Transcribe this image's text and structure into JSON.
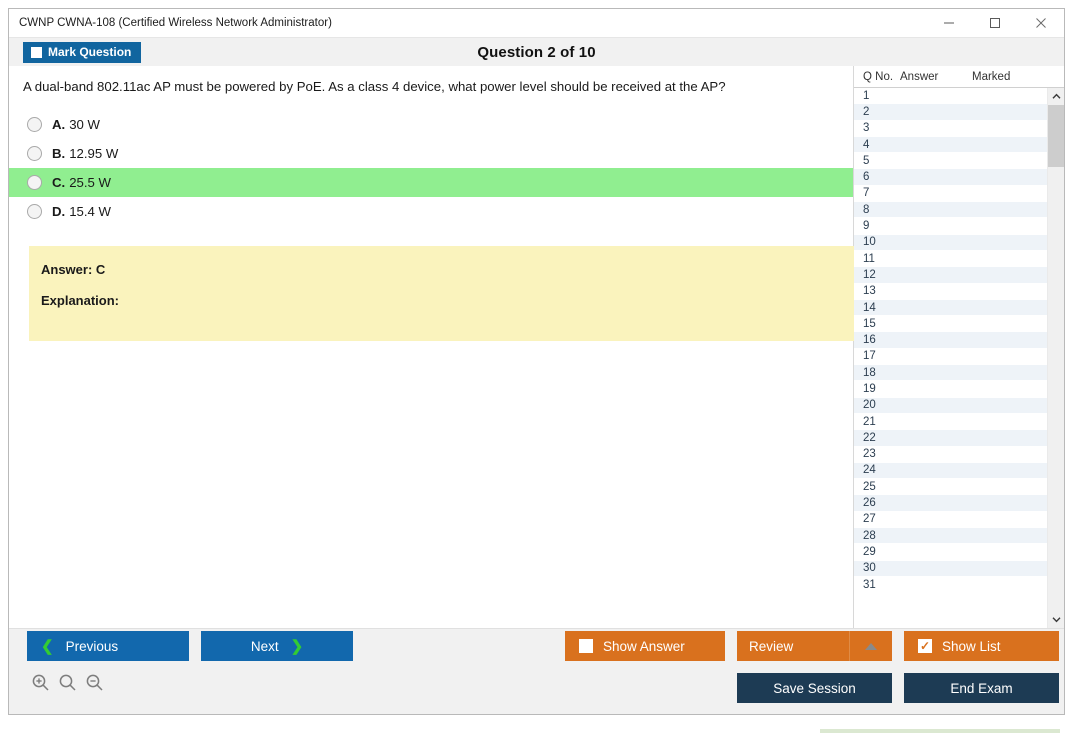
{
  "window": {
    "title": "CWNP CWNA-108 (Certified Wireless Network Administrator)",
    "controls": {
      "minimize": "minimize-icon",
      "maximize": "maximize-icon",
      "close": "close-icon"
    }
  },
  "header": {
    "mark_question_label": "Mark Question",
    "question_title": "Question 2 of 10"
  },
  "question": {
    "text": "A dual-band 802.11ac AP must be powered by PoE. As a class 4 device, what power level should be received at the AP?",
    "options": [
      {
        "letter": "A.",
        "text": "30 W",
        "correct": false
      },
      {
        "letter": "B.",
        "text": "12.95 W",
        "correct": false
      },
      {
        "letter": "C.",
        "text": "25.5 W",
        "correct": true
      },
      {
        "letter": "D.",
        "text": "15.4 W",
        "correct": false
      }
    ]
  },
  "answer_panel": {
    "answer_label": "Answer: C",
    "explanation_label": "Explanation:"
  },
  "question_list": {
    "columns": [
      "Q No.",
      "Answer",
      "Marked"
    ],
    "rows": [
      {
        "no": "1",
        "answer": "",
        "marked": ""
      },
      {
        "no": "2",
        "answer": "",
        "marked": ""
      },
      {
        "no": "3",
        "answer": "",
        "marked": ""
      },
      {
        "no": "4",
        "answer": "",
        "marked": ""
      },
      {
        "no": "5",
        "answer": "",
        "marked": ""
      },
      {
        "no": "6",
        "answer": "",
        "marked": ""
      },
      {
        "no": "7",
        "answer": "",
        "marked": ""
      },
      {
        "no": "8",
        "answer": "",
        "marked": ""
      },
      {
        "no": "9",
        "answer": "",
        "marked": ""
      },
      {
        "no": "10",
        "answer": "",
        "marked": ""
      },
      {
        "no": "11",
        "answer": "",
        "marked": ""
      },
      {
        "no": "12",
        "answer": "",
        "marked": ""
      },
      {
        "no": "13",
        "answer": "",
        "marked": ""
      },
      {
        "no": "14",
        "answer": "",
        "marked": ""
      },
      {
        "no": "15",
        "answer": "",
        "marked": ""
      },
      {
        "no": "16",
        "answer": "",
        "marked": ""
      },
      {
        "no": "17",
        "answer": "",
        "marked": ""
      },
      {
        "no": "18",
        "answer": "",
        "marked": ""
      },
      {
        "no": "19",
        "answer": "",
        "marked": ""
      },
      {
        "no": "20",
        "answer": "",
        "marked": ""
      },
      {
        "no": "21",
        "answer": "",
        "marked": ""
      },
      {
        "no": "22",
        "answer": "",
        "marked": ""
      },
      {
        "no": "23",
        "answer": "",
        "marked": ""
      },
      {
        "no": "24",
        "answer": "",
        "marked": ""
      },
      {
        "no": "25",
        "answer": "",
        "marked": ""
      },
      {
        "no": "26",
        "answer": "",
        "marked": ""
      },
      {
        "no": "27",
        "answer": "",
        "marked": ""
      },
      {
        "no": "28",
        "answer": "",
        "marked": ""
      },
      {
        "no": "29",
        "answer": "",
        "marked": ""
      },
      {
        "no": "30",
        "answer": "",
        "marked": ""
      },
      {
        "no": "31",
        "answer": "",
        "marked": ""
      }
    ]
  },
  "toolbar": {
    "previous_label": "Previous",
    "next_label": "Next",
    "show_answer_label": "Show Answer",
    "show_answer_checked": false,
    "review_label": "Review",
    "show_list_label": "Show List",
    "show_list_checked": true,
    "save_session_label": "Save Session",
    "end_exam_label": "End Exam",
    "zoom_in_icon": "zoom-in-icon",
    "zoom_reset_icon": "zoom-reset-icon",
    "zoom_out_icon": "zoom-out-icon"
  },
  "colors": {
    "primary_blue": "#1268ad",
    "accent_orange": "#d9711e",
    "navy": "#1d3b54",
    "correct_green": "#90ee90",
    "answer_yellow": "#faf3bd",
    "chevron_green": "#33cc33"
  }
}
